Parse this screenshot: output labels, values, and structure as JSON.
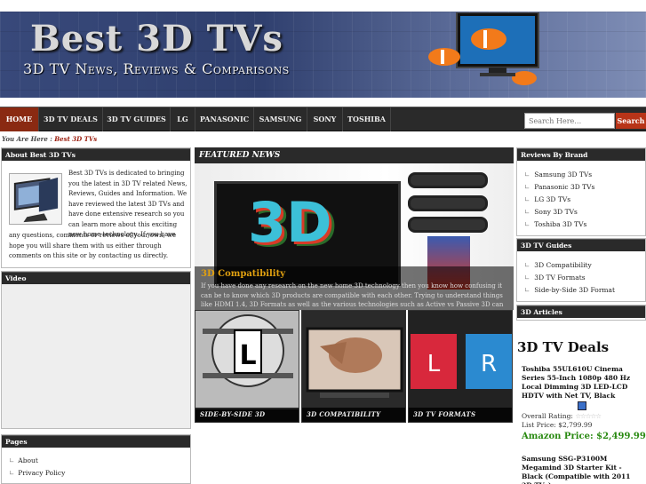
{
  "header": {
    "title": "Best 3D TVs",
    "subtitle": "3D TV News, Reviews & Comparisons"
  },
  "nav": {
    "items": [
      "HOME",
      "3D TV DEALS",
      "3D TV GUIDES",
      "LG",
      "PANASONIC",
      "SAMSUNG",
      "SONY",
      "TOSHIBA"
    ]
  },
  "search": {
    "placeholder": "Search Here…",
    "button": "Search"
  },
  "breadcrumb": {
    "prefix": "You Are Here :",
    "current": "Best 3D TVs"
  },
  "about": {
    "heading": "About Best 3D TVs",
    "text1": "Best 3D TVs is dedicated to bringing you the latest in 3D TV related News, Reviews, Guides and Information. We have reviewed the latest 3D TVs and have done extensive research so you can learn more about this exciting new home technology. If you have",
    "text2": "any questions, comments or reviews of your own, we hope you will share them with us either through comments on this site or by contacting us directly."
  },
  "video": {
    "heading": "Video"
  },
  "pages": {
    "heading": "Pages",
    "links": [
      "About",
      "Privacy Policy"
    ]
  },
  "featured": {
    "heading": "FEATURED NEWS",
    "graphic_text": "3D",
    "title": "3D Compatibility",
    "body": "If you have done any research on the new home 3D technology then you know how confusing it can be to know which 3D products are compatible with each other. Trying to understand things like HDMI 1.4, 3D Formats as well as the various technologies such as Active vs Passive 3D can be a nightmare. If you have already spent your"
  },
  "thumbs": [
    {
      "caption": "SIDE-BY-SIDE 3D FORMAT"
    },
    {
      "caption": "3D COMPATIBILITY"
    },
    {
      "caption": "3D TV FORMATS"
    }
  ],
  "thumb_art": {
    "letter_l": "L",
    "letter_r": "R"
  },
  "brands": {
    "heading": "Reviews By Brand",
    "links": [
      "Samsung 3D TVs",
      "Panasonic 3D TVs",
      "LG 3D TVs",
      "Sony 3D TVs",
      "Toshiba 3D TVs"
    ]
  },
  "guides": {
    "heading": "3D TV Guides",
    "links": [
      "3D Compatibility",
      "3D TV Formats",
      "Side-by-Side 3D Format"
    ]
  },
  "articles": {
    "heading": "3D Articles"
  },
  "deals": {
    "title": "3D TV Deals",
    "products": [
      {
        "name": "Toshiba 55UL610U Cinema Series 55-Inch 1080p 480 Hz Local Dimming 3D LED-LCD HDTV with Net TV, Black",
        "rating_label": "Overall Rating:",
        "stars": "☆☆☆☆☆",
        "list_price": "List Price: $2,799.99",
        "amazon_price": "Amazon Price: $2,499.99"
      },
      {
        "name": "Samsung SSG-P3100M Megamind 3D Starter Kit - Black (Compatible with 2011 3D TVs)"
      }
    ]
  },
  "colors": {
    "nav_active": "#8a2a12",
    "search_button": "#b83418",
    "amazon_price": "#2a8a12",
    "feature_title": "#e0a010"
  }
}
